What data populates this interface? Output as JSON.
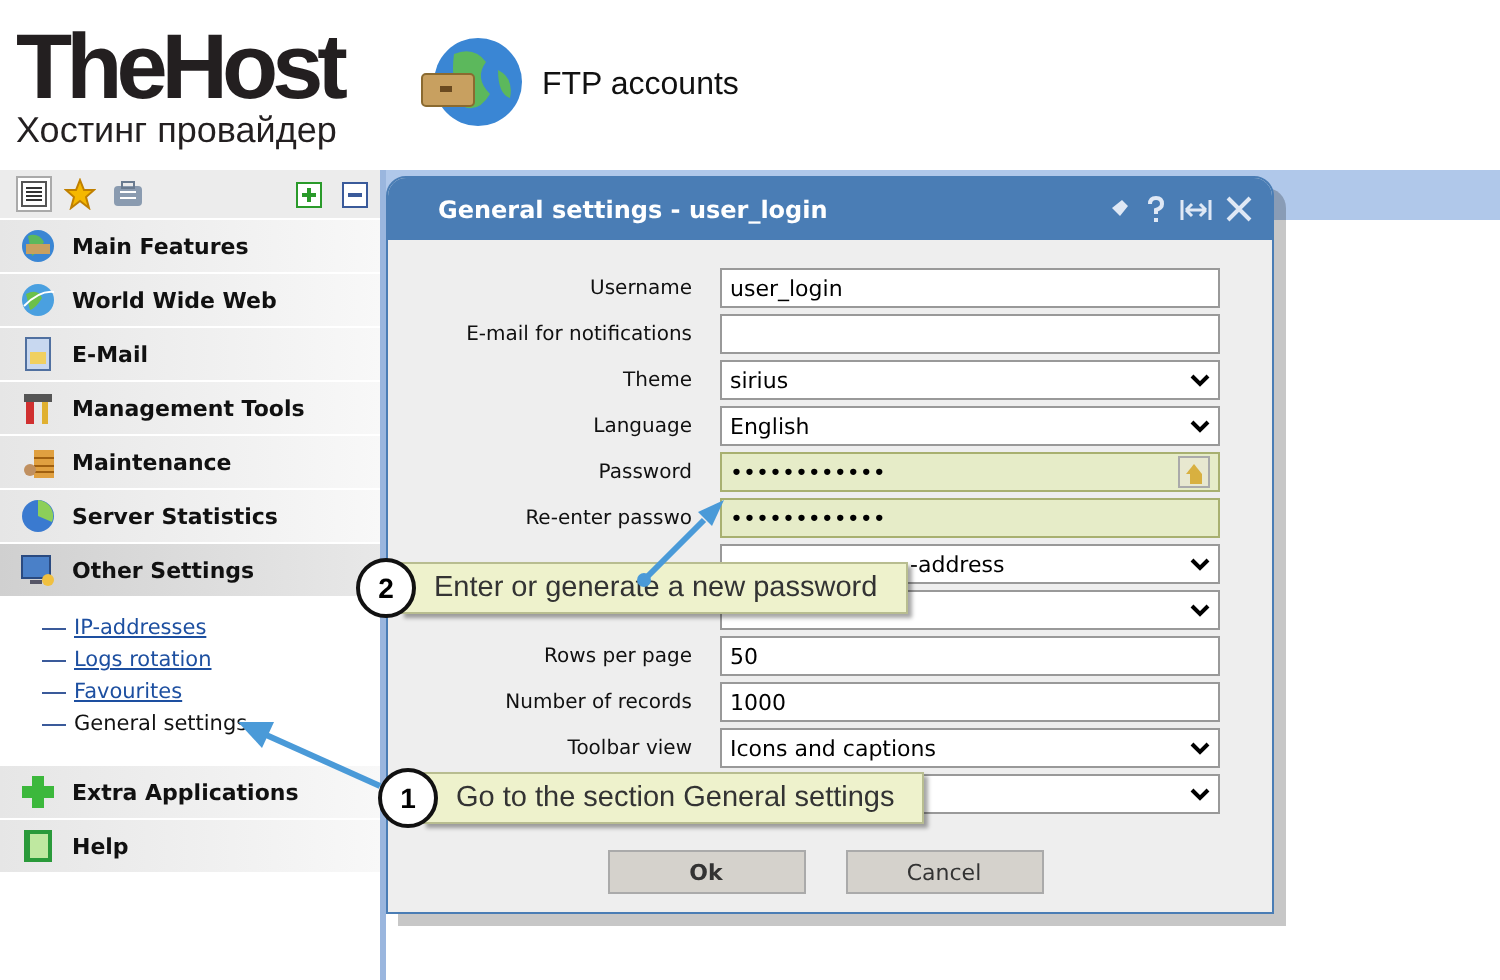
{
  "header": {
    "logo_title": "TheHost",
    "logo_subtitle": "Хостинг провайдер",
    "page_title": "FTP accounts"
  },
  "sidebar": {
    "tabs": [
      {
        "selected": true
      },
      {
        "selected": false
      },
      {
        "selected": false
      }
    ],
    "sections": [
      {
        "label": "Main Features",
        "expanded": false
      },
      {
        "label": "World Wide Web",
        "expanded": false
      },
      {
        "label": "E-Mail",
        "expanded": false
      },
      {
        "label": "Management Tools",
        "expanded": false
      },
      {
        "label": "Maintenance",
        "expanded": false
      },
      {
        "label": "Server Statistics",
        "expanded": false
      },
      {
        "label": "Other Settings",
        "expanded": true,
        "children": [
          {
            "label": "IP-addresses",
            "selected": false
          },
          {
            "label": "Logs rotation",
            "selected": false
          },
          {
            "label": "Favourites",
            "selected": false
          },
          {
            "label": "General settings",
            "selected": true
          }
        ]
      },
      {
        "label": "Extra Applications",
        "expanded": false
      },
      {
        "label": "Help",
        "expanded": false
      }
    ]
  },
  "dialog": {
    "title": "General settings - user_login",
    "rows": [
      {
        "label": "Username",
        "kind": "text",
        "value": "user_login",
        "highlighted": false
      },
      {
        "label": "E-mail for notifications",
        "kind": "text",
        "highlighted": false
      },
      {
        "label": "Theme",
        "kind": "select",
        "value": "sirius",
        "highlighted": false
      },
      {
        "label": "Language",
        "kind": "select",
        "value": "English",
        "highlighted": false
      },
      {
        "label": "Password",
        "kind": "password",
        "value": "••••••••••••",
        "highlighted": true
      },
      {
        "label": "Re-enter passwo",
        "kind": "password",
        "value": "••••••••••••",
        "highlighted": true
      },
      {
        "kind": "select",
        "value": "-address",
        "highlighted": false
      },
      {
        "kind": "select",
        "highlighted": false
      },
      {
        "label": "Rows per page",
        "kind": "text",
        "value": "50",
        "highlighted": false
      },
      {
        "label": "Number of records",
        "kind": "text",
        "value": "1000",
        "highlighted": false
      },
      {
        "label": "Toolbar view",
        "kind": "select",
        "value": "Icons and captions",
        "highlighted": false
      },
      {
        "kind": "select",
        "highlighted": false
      }
    ],
    "buttons": [
      "Ok",
      "Cancel"
    ]
  },
  "callouts": [
    {
      "number": "2",
      "text": "Enter or generate a new password"
    },
    {
      "number": "1",
      "text": "Go to the section General settings"
    }
  ]
}
